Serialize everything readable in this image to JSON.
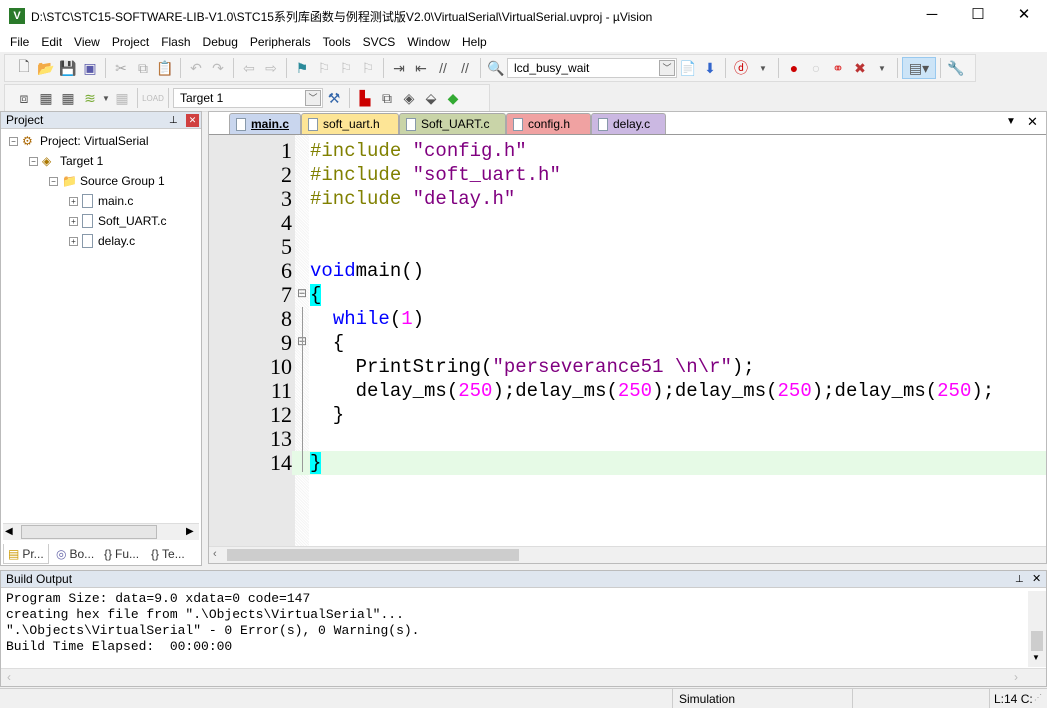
{
  "window": {
    "title": "D:\\STC\\STC15-SOFTWARE-LIB-V1.0\\STC15系列库函数与例程测试版V2.0\\VirtualSerial\\VirtualSerial.uvproj - µVision",
    "app_icon": "V",
    "minimize": "─",
    "maximize": "☐",
    "close": "✕"
  },
  "menu": [
    "File",
    "Edit",
    "View",
    "Project",
    "Flash",
    "Debug",
    "Peripherals",
    "Tools",
    "SVCS",
    "Window",
    "Help"
  ],
  "toolbar1": {
    "find_combo": "lcd_busy_wait"
  },
  "toolbar2": {
    "target_combo": "Target 1"
  },
  "project": {
    "title": "Project",
    "pin": "📌",
    "close": "✕",
    "tree": [
      {
        "label": "Project: VirtualSerial",
        "level": 0
      },
      {
        "label": "Target 1",
        "level": 1
      },
      {
        "label": "Source Group 1",
        "level": 2
      },
      {
        "label": "main.c",
        "level": 3
      },
      {
        "label": "Soft_UART.c",
        "level": 3
      },
      {
        "label": "delay.c",
        "level": 3
      }
    ],
    "tabs": [
      "Pr...",
      "Bo...",
      "Fu...",
      "Te..."
    ]
  },
  "editor": {
    "tabs": [
      {
        "label": "main.c",
        "color": "#c9d6ee",
        "active": true
      },
      {
        "label": "soft_uart.h",
        "color": "#fde596"
      },
      {
        "label": "Soft_UART.c",
        "color": "#c9d4a8"
      },
      {
        "label": "config.h",
        "color": "#f0a2a2"
      },
      {
        "label": "delay.c",
        "color": "#cbb8e2"
      }
    ],
    "current_line": 14,
    "lines": [
      [
        [
          "pp",
          "#include "
        ],
        [
          "str",
          "″config.h″"
        ]
      ],
      [
        [
          "pp",
          "#include "
        ],
        [
          "str",
          "″soft_uart.h″"
        ]
      ],
      [
        [
          "pp",
          "#include "
        ],
        [
          "str",
          "″delay.h″"
        ]
      ],
      [],
      [],
      [
        [
          "kw",
          "void"
        ],
        [
          "",
          "main()"
        ]
      ],
      [
        [
          "brm",
          "{"
        ]
      ],
      [
        [
          "",
          "  "
        ],
        [
          "kw",
          "while"
        ],
        [
          "",
          "("
        ],
        [
          "num",
          "1"
        ],
        [
          "",
          ")"
        ]
      ],
      [
        [
          "",
          "  {"
        ]
      ],
      [
        [
          "",
          "    PrintString("
        ],
        [
          "str",
          "″perseverance51 \\n\\r″"
        ],
        [
          "",
          ");"
        ]
      ],
      [
        [
          "",
          "    delay_ms("
        ],
        [
          "num",
          "250"
        ],
        [
          "",
          ");delay_ms("
        ],
        [
          "num",
          "250"
        ],
        [
          "",
          ");delay_ms("
        ],
        [
          "num",
          "250"
        ],
        [
          "",
          ");delay_ms("
        ],
        [
          "num",
          "250"
        ],
        [
          "",
          ");"
        ]
      ],
      [
        [
          "",
          "  }"
        ]
      ],
      [],
      [
        [
          "brm",
          "}"
        ]
      ]
    ]
  },
  "build_output": {
    "title": "Build Output",
    "lines": [
      "Program Size: data=9.0 xdata=0 code=147",
      "creating hex file from \".\\Objects\\VirtualSerial\"...",
      "\".\\Objects\\VirtualSerial\" - 0 Error(s), 0 Warning(s).",
      "Build Time Elapsed:  00:00:00"
    ]
  },
  "status": {
    "mode": "Simulation",
    "position": "L:14 C:"
  }
}
